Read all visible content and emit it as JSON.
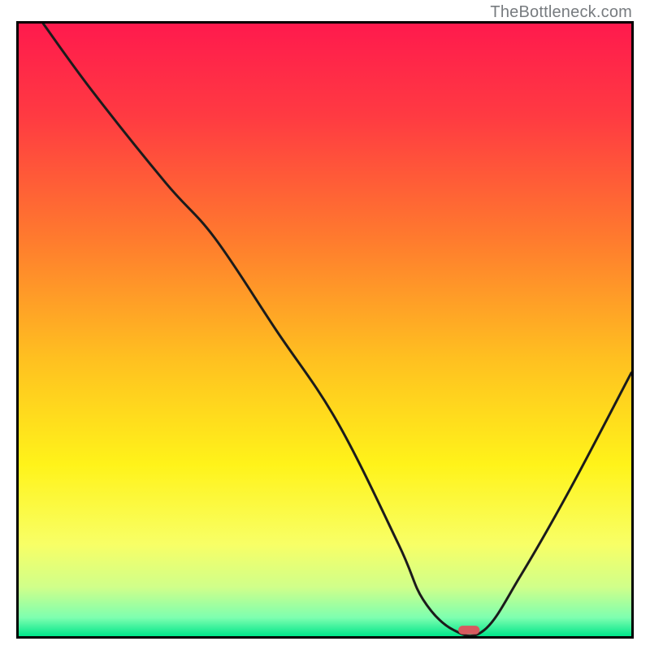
{
  "watermark": "TheBottleneck.com",
  "chart_data": {
    "type": "line",
    "title": "",
    "xlabel": "",
    "ylabel": "",
    "xlim": [
      0,
      100
    ],
    "ylim": [
      0,
      100
    ],
    "grid": false,
    "legend": false,
    "background_gradient": {
      "stops": [
        {
          "offset": 0.0,
          "color": "#ff1a4d"
        },
        {
          "offset": 0.15,
          "color": "#ff3a42"
        },
        {
          "offset": 0.35,
          "color": "#ff7a2e"
        },
        {
          "offset": 0.55,
          "color": "#ffc120"
        },
        {
          "offset": 0.72,
          "color": "#fff31a"
        },
        {
          "offset": 0.85,
          "color": "#f8ff66"
        },
        {
          "offset": 0.92,
          "color": "#d0ff8a"
        },
        {
          "offset": 0.97,
          "color": "#7dffb0"
        },
        {
          "offset": 1.0,
          "color": "#00e58a"
        }
      ]
    },
    "series": [
      {
        "name": "bottleneck-curve",
        "x": [
          4,
          12,
          24,
          32,
          42,
          52,
          62,
          66,
          71,
          76,
          82,
          90,
          100
        ],
        "y": [
          100,
          89,
          74,
          65,
          50,
          35,
          15,
          6,
          1,
          1,
          10,
          24,
          43
        ]
      }
    ],
    "marker": {
      "name": "optimal-point",
      "x": 73.5,
      "y": 1,
      "width": 3.5,
      "height": 1.4,
      "color": "#d75a5f"
    }
  }
}
